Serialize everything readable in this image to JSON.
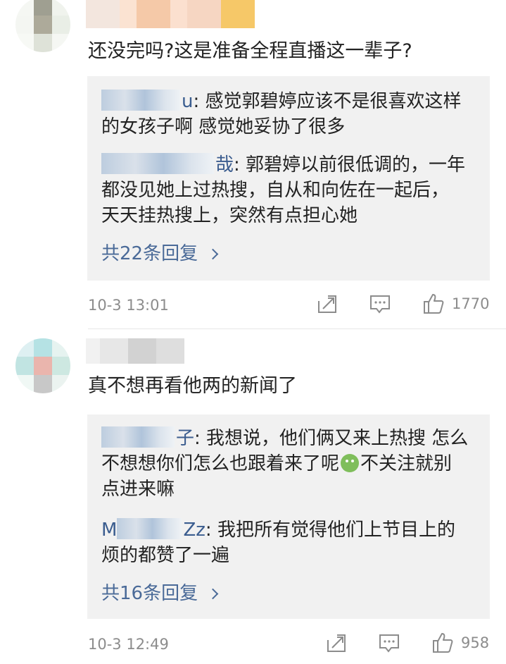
{
  "comments": [
    {
      "text": "还没完吗?这是准备全程直播这一辈子?",
      "replies": [
        {
          "name_suffix": "u",
          "text_lines": [
            "感觉郭碧婷应该不是很喜欢这样",
            "的女孩子啊 感觉她妥协了很多"
          ]
        },
        {
          "name_suffix": "哉",
          "text_lines": [
            "郭碧婷以前很低调的，一年",
            "都没见她上过热搜，自从和向佐在一起后，",
            "天天挂热搜上，突然有点担心她"
          ]
        }
      ],
      "more_replies": "共22条回复",
      "time": "10-3 13:01",
      "likes": "1770"
    },
    {
      "text": "真不想再看他两的新闻了",
      "replies": [
        {
          "name_suffix": "子",
          "text_lines": [
            "我想说，他们俩又来上热搜 怎么",
            "不想想你们怎么也跟着来了呢",
            "不关注就别",
            "点进来嘛"
          ]
        },
        {
          "name_prefix": "M",
          "name_suffix": "Zz",
          "text_lines": [
            "我把所有觉得他们上节目上的",
            "烦的都赞了一遍"
          ]
        }
      ],
      "more_replies": "共16条回复",
      "time": "10-3 12:49",
      "likes": "958"
    }
  ],
  "icons": {
    "share": "share-icon",
    "comment": "comment-icon",
    "like": "thumbs-up-icon",
    "chevron": "chevron-right-icon",
    "emoji": "green-face-emoji"
  },
  "colors": {
    "link": "#4a6a98",
    "reply_bg": "#f1f1f1",
    "meta": "#8c8c8c"
  }
}
